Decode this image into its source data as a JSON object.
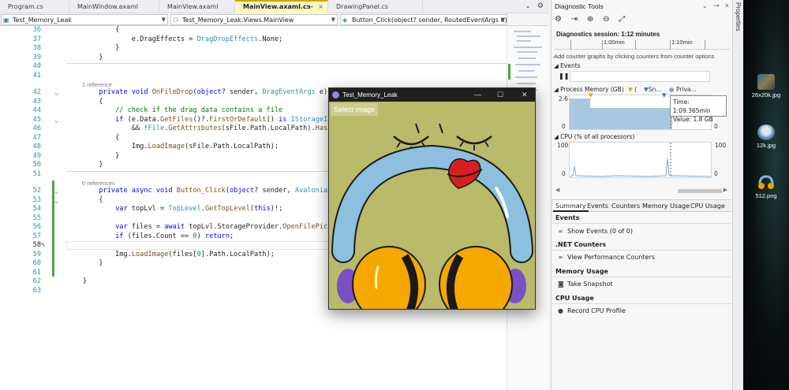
{
  "tabs": [
    {
      "label": "Program.cs"
    },
    {
      "label": "MainWindow.axaml"
    },
    {
      "label": "MainView.axaml"
    },
    {
      "label": "MainView.axaml.cs",
      "active": true
    },
    {
      "label": "DrawingPanel.cs"
    }
  ],
  "nav": {
    "project": "Test_Memory_Leak",
    "type": "Test_Memory_Leak.Views.MainView",
    "member": "Button_Click(object? sender, RoutedEventArgs e)"
  },
  "code_lines": [
    {
      "n": "36",
      "text": "            {"
    },
    {
      "n": "37",
      "text": "                e.DragEffects = DragDropEffects.None;"
    },
    {
      "n": "38",
      "text": "            }"
    },
    {
      "n": "39",
      "text": "        }"
    },
    {
      "n": "40",
      "text": ""
    },
    {
      "n": "41",
      "text": ""
    },
    {
      "n": "42",
      "text": "        private void OnFileDrop(object? sender, DragEventArgs e)"
    },
    {
      "n": "43",
      "text": "        {"
    },
    {
      "n": "44",
      "text": "            // check if the drag data contains a file"
    },
    {
      "n": "45",
      "text": "            if (e.Data.GetFiles()?.FirstOrDefault() is IStorageItem"
    },
    {
      "n": "46",
      "text": "                && !File.GetAttributes(sFile.Path.LocalPath).HasFlag"
    },
    {
      "n": "47",
      "text": "            {"
    },
    {
      "n": "48",
      "text": "                Img.LoadImage(sFile.Path.LocalPath);"
    },
    {
      "n": "49",
      "text": "            }"
    },
    {
      "n": "50",
      "text": "        }"
    },
    {
      "n": "51",
      "text": ""
    },
    {
      "n": "52",
      "text": "        private async void Button_Click(object? sender, Avalonia.Int"
    },
    {
      "n": "53",
      "text": "        {"
    },
    {
      "n": "54",
      "text": "            var topLvl = TopLevel.GetTopLevel(this)!;"
    },
    {
      "n": "55",
      "text": ""
    },
    {
      "n": "56",
      "text": "            var files = await topLvl.StorageProvider.OpenFilePicker/"
    },
    {
      "n": "57",
      "text": "            if (files.Count == 0) return;"
    },
    {
      "n": "58",
      "text": ""
    },
    {
      "n": "59",
      "text": "            Img.LoadImage(files[0].Path.LocalPath);"
    },
    {
      "n": "60",
      "text": "        }"
    },
    {
      "n": "61",
      "text": ""
    },
    {
      "n": "62",
      "text": "    }"
    },
    {
      "n": "63",
      "text": ""
    }
  ],
  "lens": {
    "ref1": "1 reference",
    "ref0": "0 references"
  },
  "diag": {
    "title": "Diagnostic Tools",
    "session": "Diagnostics session: 1:12 minutes",
    "tl_1": "1:00min",
    "tl_2": "1:10min",
    "add_counter": "Add counter graphs by clicking counters from counter options",
    "events": "Events",
    "process_memory": "Process Memory (GB)",
    "legend_sn": "Sn...",
    "legend_priv": "Priva...",
    "mem_max": "2.6",
    "mem_min": "0",
    "cpu": "CPU (% of all processors)",
    "cpu_max": "100",
    "cpu_min": "0",
    "tooltip_time": "Time: 1:09.365min",
    "tooltip_value": "Value: 1.8 GB",
    "tabs": [
      "Summary",
      "Events",
      "Counters",
      "Memory Usage",
      "CPU Usage"
    ],
    "sections": [
      {
        "header": "Events",
        "item": "Show Events (0 of 0)"
      },
      {
        "header": ".NET Counters",
        "item": "View Performance Counters"
      },
      {
        "header": "Memory Usage",
        "item": "Take Snapshot"
      },
      {
        "header": "CPU Usage",
        "item": "Record CPU Profile"
      }
    ]
  },
  "properties_label": "Properties",
  "desktop_icons": [
    {
      "label": "26x20k.jpg"
    },
    {
      "label": "12k.jpg"
    },
    {
      "label": "512.png"
    }
  ],
  "app": {
    "title": "Test_Memory_Leak",
    "select_button": "Select image",
    "background": "#baba6b"
  },
  "colors": {
    "accent_tab": "#d0a600",
    "memory_fill": "#a9c8e0",
    "change_bar": "#4aa84a"
  }
}
